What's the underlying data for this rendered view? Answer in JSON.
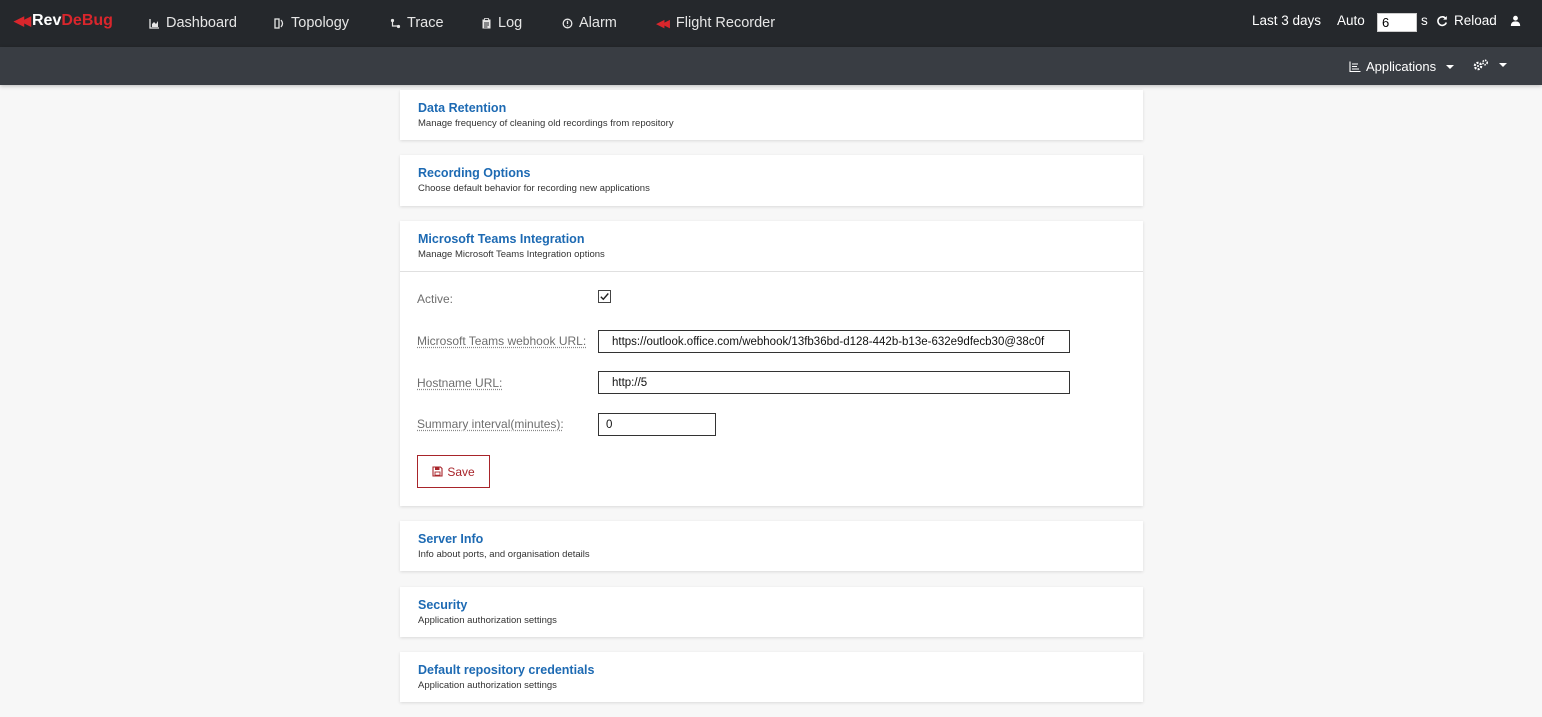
{
  "brand": {
    "name_part1": "Rev",
    "name_part2": "DeBug"
  },
  "nav": {
    "dashboard": "Dashboard",
    "topology": "Topology",
    "trace": "Trace",
    "log": "Log",
    "alarm": "Alarm",
    "flight_recorder": "Flight Recorder"
  },
  "toolbar": {
    "time_range": "Last 3 days",
    "auto_label": "Auto",
    "interval_value": "6",
    "interval_unit": "s",
    "reload_label": "Reload"
  },
  "subbar": {
    "applications_label": "Applications"
  },
  "sections": {
    "data_retention": {
      "title": "Data Retention",
      "subtitle": "Manage frequency of cleaning old recordings from repository"
    },
    "recording_options": {
      "title": "Recording Options",
      "subtitle": "Choose default behavior for recording new applications"
    },
    "teams": {
      "title": "Microsoft Teams Integration",
      "subtitle": "Manage Microsoft Teams Integration options",
      "active_label": "Active:",
      "active_checked": true,
      "webhook_label": "Microsoft Teams webhook URL:",
      "webhook_value": "https://outlook.office.com/webhook/13fb36bd-d128-442b-b13e-632e9dfecb30@38c0f",
      "hostname_label": "Hostname URL:",
      "hostname_value": "http://5",
      "summary_label": "Summary interval(minutes):",
      "summary_value": "0",
      "save_label": "Save"
    },
    "server_info": {
      "title": "Server Info",
      "subtitle": "Info about ports, and organisation details"
    },
    "security": {
      "title": "Security",
      "subtitle": "Application authorization settings"
    },
    "repo_credentials": {
      "title": "Default repository credentials",
      "subtitle": "Application authorization settings"
    }
  },
  "colors": {
    "accent_blue": "#1d6ab3",
    "brand_red": "#d9262c",
    "topbar_bg": "#25282c",
    "subbar_bg": "#393d43"
  }
}
